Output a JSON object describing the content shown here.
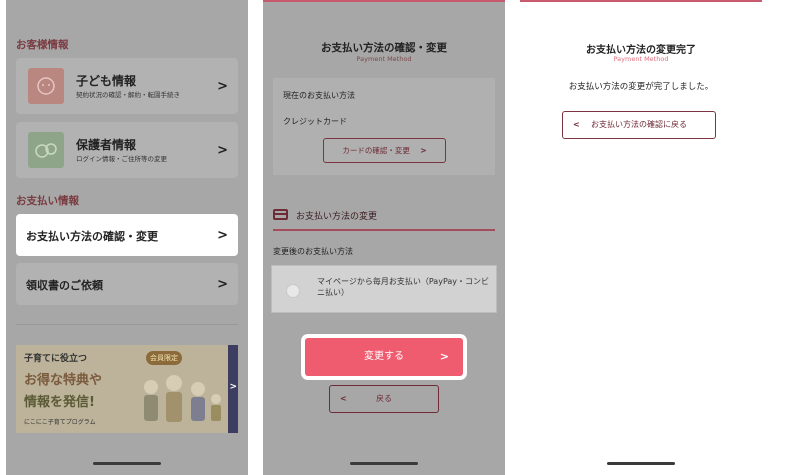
{
  "panel1": {
    "customer_header": "お客様情報",
    "child_card": {
      "title": "子ども情報",
      "subtitle": "契約状況の確認・解約・転園手続き",
      "chevron": ">"
    },
    "guardian_card": {
      "title": "保護者情報",
      "subtitle": "ログイン情報・ご住所等の変更",
      "chevron": ">"
    },
    "payment_header": "お支払い情報",
    "payment_method_row": {
      "label": "お支払い方法の確認・変更",
      "chevron": ">"
    },
    "receipt_row": {
      "label": "領収書のご依頼",
      "chevron": ">"
    },
    "banner": {
      "line1": "子育てに役立つ",
      "line2": "お得な特典や",
      "line3": "情報を発信!",
      "badge": "会員限定",
      "logo": "にこにこ子育てプログラム",
      "arrow": ">"
    }
  },
  "panel2": {
    "title": "お支払い方法の確認・変更",
    "subtitle": "Payment Method",
    "current_label": "現在のお支払い方法",
    "current_value": "クレジットカード",
    "card_button": "カードの確認・変更",
    "card_button_arrow": ">",
    "change_header": "お支払い方法の変更",
    "after_label": "変更後のお支払い方法",
    "option_text": "マイページから毎月お支払い（PayPay・コンビニ払い）",
    "submit_label": "変更する",
    "submit_arrow": ">",
    "back_label": "戻る",
    "back_arrow": "<"
  },
  "panel3": {
    "title": "お支払い方法の変更完了",
    "subtitle": "Payment Method",
    "message": "お支払い方法の変更が完了しました。",
    "return_label": "お支払い方法の確認に戻る",
    "return_arrow": "<"
  }
}
